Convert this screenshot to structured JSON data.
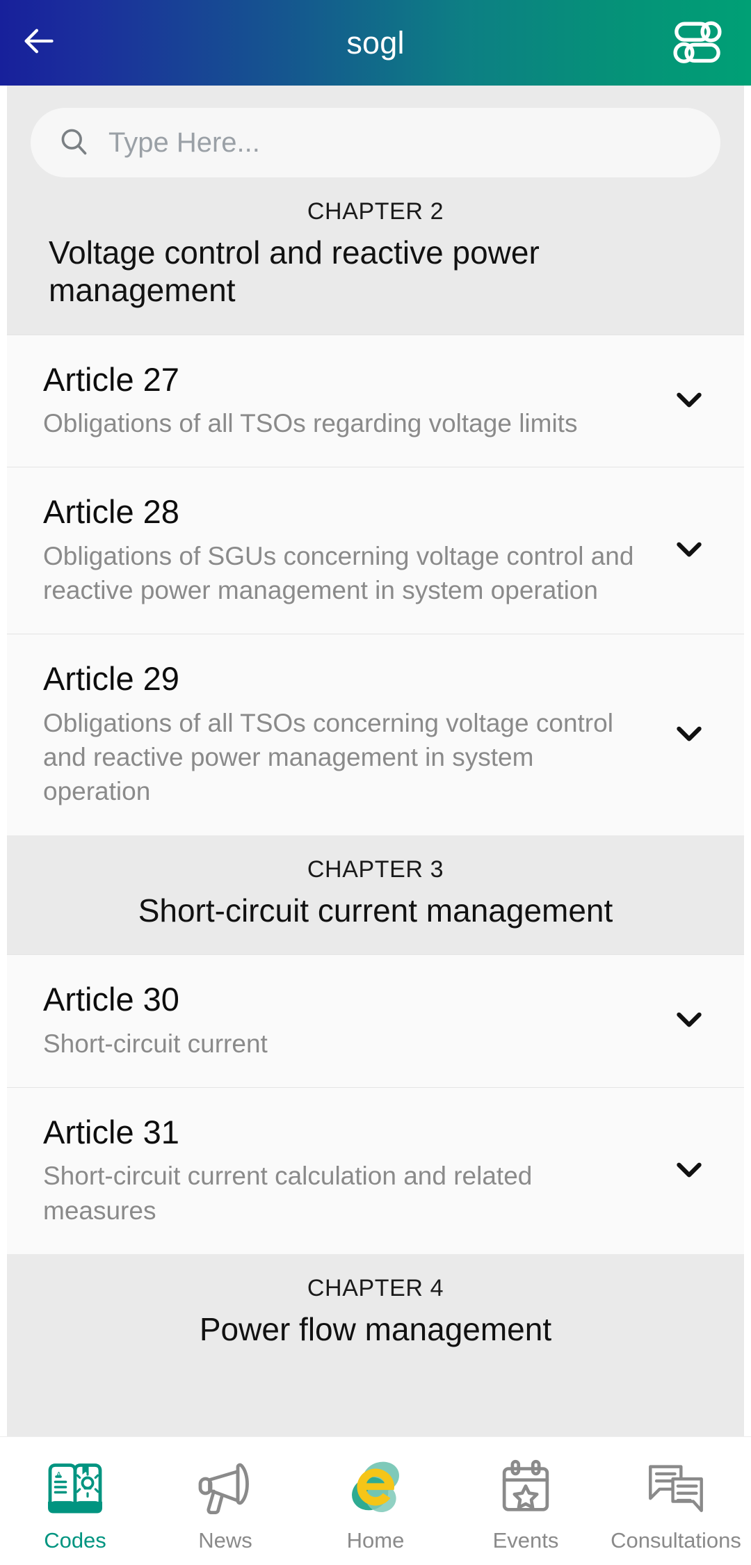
{
  "header": {
    "title": "sogl",
    "back_icon": "arrow-left-icon",
    "action_icon": "filter-sliders-icon",
    "gradient_from": "#17209b",
    "gradient_to": "#00a075"
  },
  "search": {
    "placeholder": "Type Here...",
    "value": "",
    "icon": "search-icon"
  },
  "sections": [
    {
      "type": "chapter",
      "eyebrow": "CHAPTER 2",
      "title": "Voltage control and reactive power management",
      "wrap": true
    },
    {
      "type": "article",
      "title": "Article 27",
      "subtitle": "Obligations of all TSOs regarding voltage limits",
      "expand_icon": "chevron-down-icon"
    },
    {
      "type": "article",
      "title": "Article 28",
      "subtitle": "Obligations of SGUs concerning voltage control and reactive power management in system operation",
      "expand_icon": "chevron-down-icon"
    },
    {
      "type": "article",
      "title": "Article 29",
      "subtitle": "Obligations of all TSOs concerning voltage control and reactive power management in system operation",
      "expand_icon": "chevron-down-icon"
    },
    {
      "type": "chapter",
      "eyebrow": "CHAPTER 3",
      "title": "Short-circuit current management",
      "wrap": false
    },
    {
      "type": "article",
      "title": "Article 30",
      "subtitle": "Short-circuit current",
      "expand_icon": "chevron-down-icon"
    },
    {
      "type": "article",
      "title": "Article 31",
      "subtitle": "Short-circuit current calculation and related measures",
      "expand_icon": "chevron-down-icon"
    },
    {
      "type": "chapter",
      "eyebrow": "CHAPTER 4",
      "title": "Power flow management",
      "wrap": false
    }
  ],
  "bottom_nav": {
    "active_index": 0,
    "active_color": "#009480",
    "inactive_color": "#8a8a8a",
    "items": [
      {
        "label": "Codes",
        "icon": "book-lightbulb-icon",
        "active": true
      },
      {
        "label": "News",
        "icon": "megaphone-icon",
        "active": false
      },
      {
        "label": "Home",
        "icon": "entsoe-e-logo-icon",
        "active": false
      },
      {
        "label": "Events",
        "icon": "calendar-star-icon",
        "active": false
      },
      {
        "label": "Consultations",
        "icon": "chat-bubbles-icon",
        "active": false
      }
    ]
  }
}
